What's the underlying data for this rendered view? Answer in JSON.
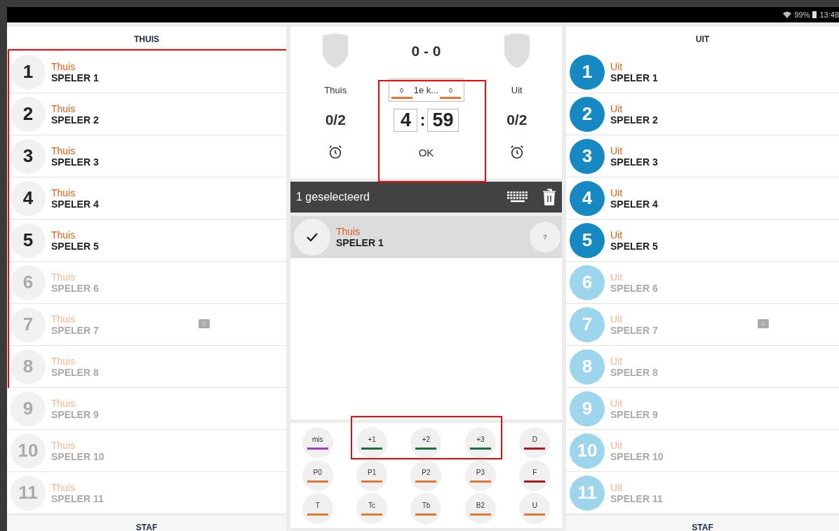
{
  "status_bar": {
    "battery": "99%",
    "time": "13:48"
  },
  "home": {
    "header": "THUIS",
    "footer": "STAF",
    "players": [
      {
        "number": "1",
        "team": "Thuis",
        "name": "SPELER 1",
        "active": true
      },
      {
        "number": "2",
        "team": "Thuis",
        "name": "SPELER 2",
        "active": true
      },
      {
        "number": "3",
        "team": "Thuis",
        "name": "SPELER 3",
        "active": true
      },
      {
        "number": "4",
        "team": "Thuis",
        "name": "SPELER 4",
        "active": true
      },
      {
        "number": "5",
        "team": "Thuis",
        "name": "SPELER 5",
        "active": true
      },
      {
        "number": "6",
        "team": "Thuis",
        "name": "SPELER 6",
        "active": false
      },
      {
        "number": "7",
        "team": "Thuis",
        "name": "SPELER 7",
        "active": false,
        "badge": "C"
      },
      {
        "number": "8",
        "team": "Thuis",
        "name": "SPELER 8",
        "active": false
      },
      {
        "number": "9",
        "team": "Thuis",
        "name": "SPELER 9",
        "active": false
      },
      {
        "number": "10",
        "team": "Thuis",
        "name": "SPELER 10",
        "active": false
      },
      {
        "number": "11",
        "team": "Thuis",
        "name": "SPELER 11",
        "active": false
      }
    ]
  },
  "scoreboard": {
    "score": "0 - 0",
    "home_name": "Thuis",
    "away_name": "Uit",
    "home_fouls": "0/2",
    "away_fouls": "0/2",
    "period": {
      "home": "0",
      "label": "1e k...",
      "away": "0"
    },
    "minutes": "4",
    "separator": ":",
    "seconds": "59",
    "ok": "OK"
  },
  "selection": {
    "title": "1 geselecteerd",
    "items": [
      {
        "team": "Thuis",
        "name": "SPELER 1",
        "checked": true,
        "help": "?"
      }
    ]
  },
  "actions": [
    {
      "label": "mis",
      "color": "#a040c8"
    },
    {
      "label": "+1",
      "color": "#1e6b3a"
    },
    {
      "label": "+2",
      "color": "#1e6b3a"
    },
    {
      "label": "+3",
      "color": "#1e6b3a"
    },
    {
      "label": "D",
      "color": "#b01818"
    },
    {
      "label": "P0",
      "color": "#e07a30"
    },
    {
      "label": "P1",
      "color": "#e07a30"
    },
    {
      "label": "P2",
      "color": "#e07a30"
    },
    {
      "label": "P3",
      "color": "#e07a30"
    },
    {
      "label": "F",
      "color": "#b01818"
    },
    {
      "label": "T",
      "color": "#e07a30"
    },
    {
      "label": "Tc",
      "color": "#e07a30"
    },
    {
      "label": "Tb",
      "color": "#e07a30"
    },
    {
      "label": "B2",
      "color": "#e07a30"
    },
    {
      "label": "U",
      "color": "#e07a30"
    }
  ],
  "away": {
    "header": "UIT",
    "footer": "STAF",
    "players": [
      {
        "number": "1",
        "team": "Uit",
        "name": "SPELER 1",
        "active": true
      },
      {
        "number": "2",
        "team": "Uit",
        "name": "SPELER 2",
        "active": true
      },
      {
        "number": "3",
        "team": "Uit",
        "name": "SPELER 3",
        "active": true
      },
      {
        "number": "4",
        "team": "Uit",
        "name": "SPELER 4",
        "active": true
      },
      {
        "number": "5",
        "team": "Uit",
        "name": "SPELER 5",
        "active": true
      },
      {
        "number": "6",
        "team": "Uit",
        "name": "SPELER 6",
        "active": false
      },
      {
        "number": "7",
        "team": "Uit",
        "name": "SPELER 7",
        "active": false,
        "badge": "C"
      },
      {
        "number": "8",
        "team": "Uit",
        "name": "SPELER 8",
        "active": false
      },
      {
        "number": "9",
        "team": "Uit",
        "name": "SPELER 9",
        "active": false
      },
      {
        "number": "10",
        "team": "Uit",
        "name": "SPELER 10",
        "active": false
      },
      {
        "number": "11",
        "team": "Uit",
        "name": "SPELER 11",
        "active": false
      }
    ]
  },
  "highlights": [
    {
      "kind": "home_rows"
    },
    {
      "kind": "clock"
    },
    {
      "kind": "score_actions"
    }
  ]
}
